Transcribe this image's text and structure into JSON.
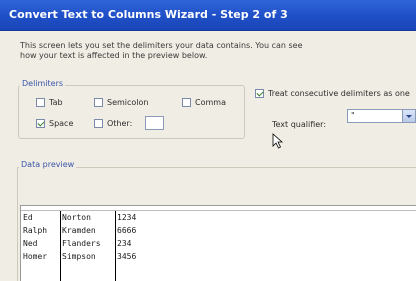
{
  "window": {
    "title": "Convert Text to Columns Wizard - Step 2 of 3"
  },
  "intro": {
    "line1": "This screen lets you set the delimiters your data contains.  You can see",
    "line2": "how your text is affected in the preview below."
  },
  "delimiters": {
    "legend": "Delimiters",
    "tab": {
      "label": "Tab",
      "checked": false
    },
    "semicolon": {
      "label": "Semicolon",
      "checked": false
    },
    "comma": {
      "label": "Comma",
      "checked": false
    },
    "space": {
      "label": "Space",
      "checked": true
    },
    "other": {
      "label": "Other:",
      "checked": false,
      "value": ""
    }
  },
  "consecutive": {
    "label": "Treat consecutive delimiters as one",
    "checked": true
  },
  "qualifier": {
    "label": "Text qualifier:",
    "value": "\""
  },
  "preview": {
    "legend": "Data preview",
    "rows": [
      [
        "Ed",
        "Norton",
        "1234"
      ],
      [
        "Ralph",
        "Kramden",
        "6666"
      ],
      [
        "Ned",
        "Flanders",
        "234"
      ],
      [
        "Homer",
        "Simpson",
        "3456"
      ]
    ]
  }
}
